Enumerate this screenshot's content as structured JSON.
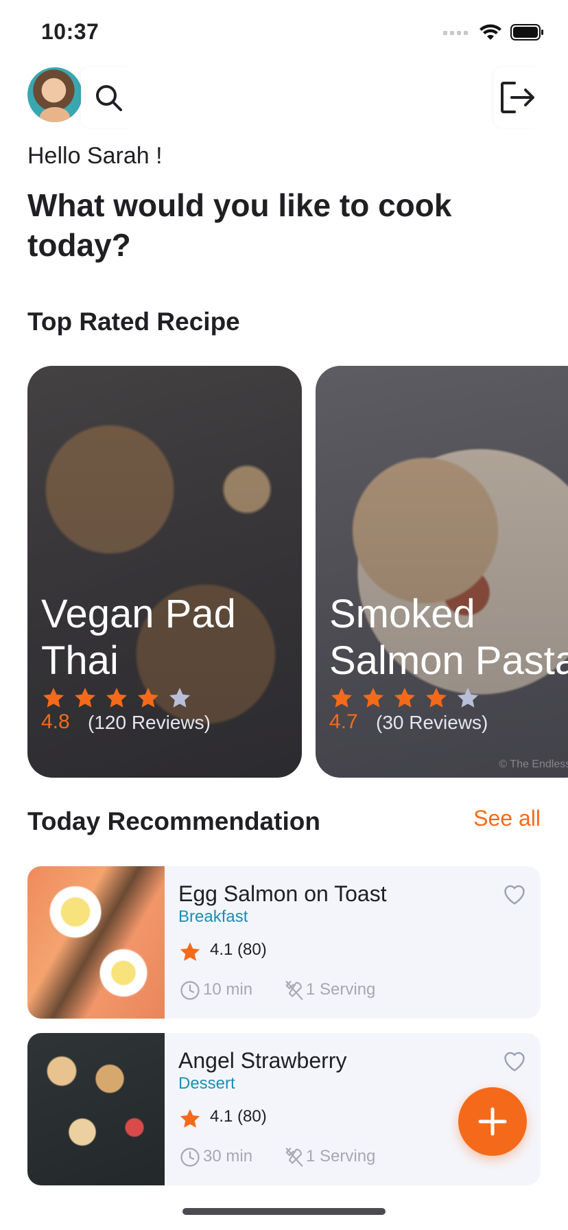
{
  "status_bar": {
    "time": "10:37"
  },
  "header": {
    "avatar_alt": "Sarah"
  },
  "greeting": "Hello Sarah !",
  "headline": "What would you like to cook today?",
  "top_rated": {
    "title": "Top Rated Recipe",
    "cards": [
      {
        "title_line1": "Vegan Pad",
        "title_line2": "Thai",
        "rating": "4.8",
        "reviews": "(120 Reviews)",
        "stars_filled": 4,
        "stars_total": 5
      },
      {
        "title_line1": "Smoked",
        "title_line2": "Salmon Pasta",
        "rating": "4.7",
        "reviews": "(30 Reviews)",
        "stars_filled": 4,
        "stars_total": 5,
        "copyright": "© The Endless M"
      }
    ]
  },
  "today": {
    "title": "Today Recommendation",
    "see_all": "See all",
    "items": [
      {
        "name": "Egg Salmon on Toast",
        "category": "Breakfast",
        "rating": "4.1 (80)",
        "time": "10 min",
        "serving": "1 Serving"
      },
      {
        "name": "Angel Strawberry",
        "category": "Dessert",
        "rating": "4.1 (80)",
        "time": "30 min",
        "serving": "1 Serving"
      }
    ]
  },
  "colors": {
    "accent": "#f56a1a",
    "category": "#1a8fb3",
    "muted": "#a6a8b2"
  },
  "icons": [
    "search-icon",
    "logout-icon",
    "star-icon",
    "clock-icon",
    "utensils-icon",
    "heart-icon",
    "plus-icon",
    "wifi-icon",
    "battery-icon",
    "signal-icon"
  ]
}
